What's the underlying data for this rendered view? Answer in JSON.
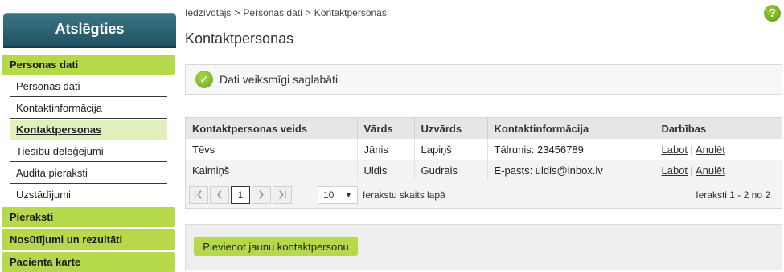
{
  "sidebar": {
    "logout_label": "Atslēgties",
    "sections": [
      {
        "label": "Personas dati"
      },
      {
        "label": "Pieraksti"
      },
      {
        "label": "Nosūtījumi un rezultāti"
      },
      {
        "label": "Pacienta karte"
      }
    ],
    "sub_items": [
      {
        "label": "Personas dati"
      },
      {
        "label": "Kontaktinformācija"
      },
      {
        "label": "Kontaktpersonas",
        "active": true
      },
      {
        "label": "Tiesību deleģējumi"
      },
      {
        "label": "Audita pieraksti"
      },
      {
        "label": "Uzstādījumi"
      }
    ]
  },
  "breadcrumb": {
    "items": [
      "Iedzīvotājs",
      "Personas dati",
      "Kontaktpersonas"
    ],
    "separator": ">"
  },
  "help_glyph": "?",
  "page_title": "Kontaktpersonas",
  "success": {
    "text": "Dati veiksmīgi saglabāti",
    "icon": "check-icon"
  },
  "table": {
    "headers": [
      "Kontaktpersonas veids",
      "Vārds",
      "Uzvārds",
      "Kontaktinformācija",
      "Darbības"
    ],
    "rows": [
      {
        "type": "Tēvs",
        "name": "Jānis",
        "surname": "Lapiņš",
        "contact": "Tālrunis: 23456789",
        "edit": "Labot",
        "sep": "|",
        "cancel": "Anulēt"
      },
      {
        "type": "Kaimiņš",
        "name": "Uldis",
        "surname": "Gudrais",
        "contact": "E-pasts: uldis@inbox.lv",
        "edit": "Labot",
        "sep": "|",
        "cancel": "Anulēt"
      }
    ]
  },
  "pager": {
    "current_page": "1",
    "page_size": "10",
    "page_size_label": "Ierakstu skaits lapā",
    "info": "Ieraksti 1 - 2 no 2"
  },
  "add_button_label": "Pievienot jaunu kontaktpersonu",
  "colors": {
    "accent_green": "#b5d94b",
    "logout_blue": "#2d6575",
    "active_item_bg": "#e1efbf"
  }
}
